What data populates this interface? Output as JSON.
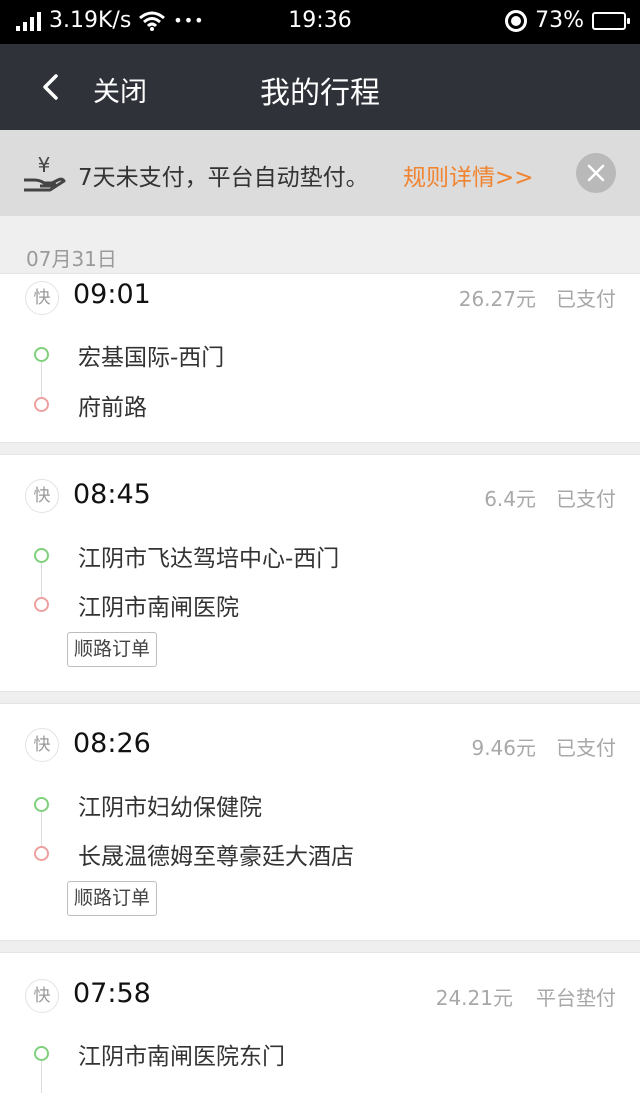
{
  "status_bar": {
    "speed": "3.19K/s",
    "dots": "•••",
    "time": "19:36",
    "battery": "73%",
    "battery_level": 0.73
  },
  "nav": {
    "close_label": "关闭",
    "title": "我的行程"
  },
  "notice": {
    "text": "7天未支付，平台自动垫付。",
    "link": "规则详情>>",
    "accent_color": "#f08431"
  },
  "date_label": "07月31日",
  "trips": [
    {
      "type": "快",
      "time": "09:01",
      "price": "26.27元",
      "status": "已支付",
      "from": "宏基国际-西门",
      "to": "府前路",
      "tag": ""
    },
    {
      "type": "快",
      "time": "08:45",
      "price": "6.4元",
      "status": "已支付",
      "from": "江阴市飞达驾培中心-西门",
      "to": "江阴市南闸医院",
      "tag": "顺路订单"
    },
    {
      "type": "快",
      "time": "08:26",
      "price": "9.46元",
      "status": "已支付",
      "from": "江阴市妇幼保健院",
      "to": "长晟温德姆至尊豪廷大酒店",
      "tag": "顺路订单"
    },
    {
      "type": "快",
      "time": "07:58",
      "price": "24.21元",
      "status": "平台垫付",
      "from": "江阴市南闸医院东门",
      "to": "",
      "tag": ""
    }
  ],
  "colors": {
    "nav_bg": "#2f3238",
    "start_dot": "#7fd07a",
    "end_dot": "#ee9f9f"
  }
}
